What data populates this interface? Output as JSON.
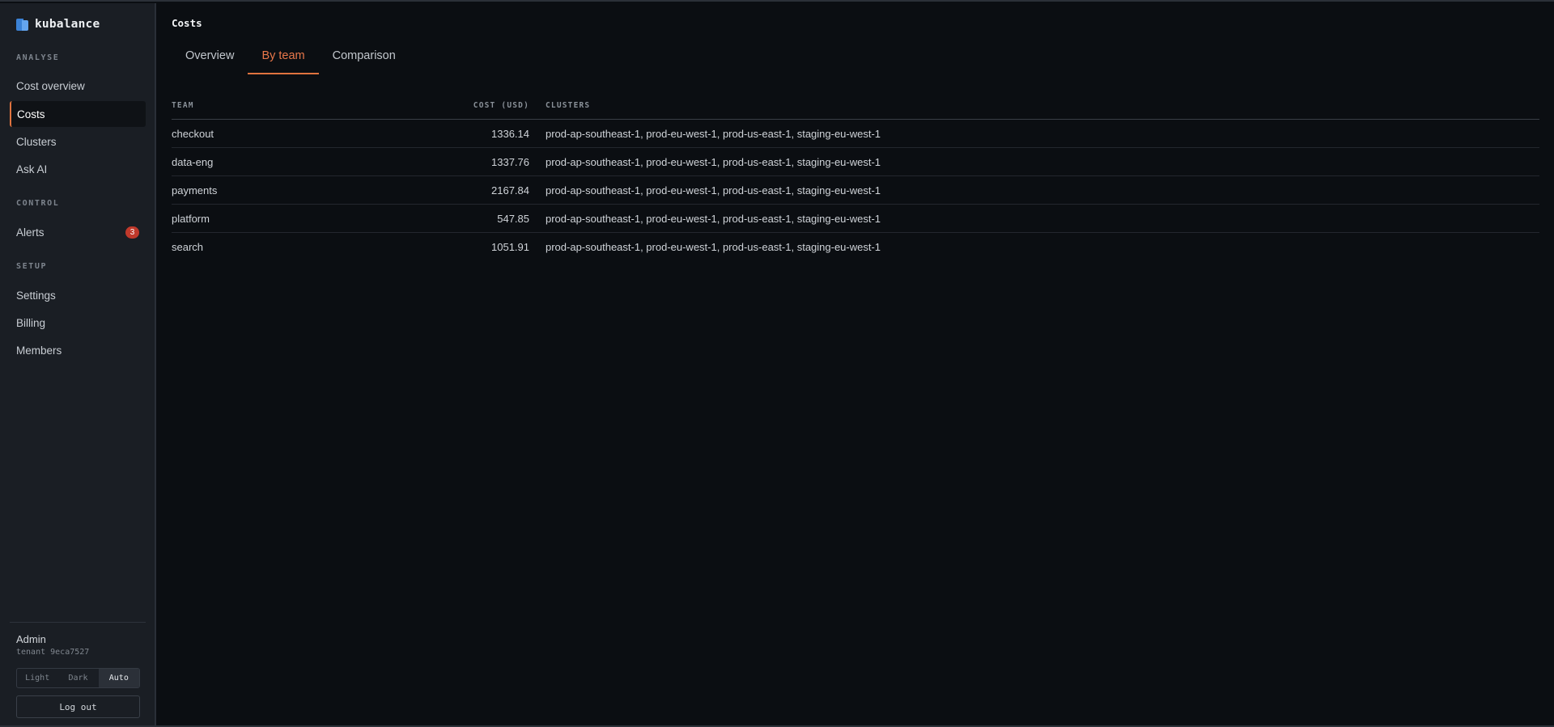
{
  "brand": {
    "name": "kubalance"
  },
  "sidebar": {
    "sections": [
      {
        "label": "ANALYSE"
      },
      {
        "label": "CONTROL"
      },
      {
        "label": "SETUP"
      }
    ],
    "items": [
      {
        "label": "Cost overview"
      },
      {
        "label": "Costs"
      },
      {
        "label": "Clusters"
      },
      {
        "label": "Ask AI"
      },
      {
        "label": "Alerts",
        "badge": "3"
      },
      {
        "label": "Settings"
      },
      {
        "label": "Billing"
      },
      {
        "label": "Members"
      }
    ],
    "active_item": "Costs"
  },
  "user": {
    "name": "Admin",
    "tenant": "tenant 9eca7527"
  },
  "theme": {
    "options": [
      "Light",
      "Dark",
      "Auto"
    ],
    "selected": "Auto"
  },
  "logout_label": "Log out",
  "page": {
    "title": "Costs",
    "tabs": [
      {
        "label": "Overview"
      },
      {
        "label": "By team"
      },
      {
        "label": "Comparison"
      }
    ],
    "active_tab": "By team"
  },
  "table": {
    "headers": {
      "team": "TEAM",
      "cost": "COST (USD)",
      "clusters": "CLUSTERS"
    },
    "rows": [
      {
        "team": "checkout",
        "cost": "1336.14",
        "clusters": "prod-ap-southeast-1, prod-eu-west-1, prod-us-east-1, staging-eu-west-1"
      },
      {
        "team": "data-eng",
        "cost": "1337.76",
        "clusters": "prod-ap-southeast-1, prod-eu-west-1, prod-us-east-1, staging-eu-west-1"
      },
      {
        "team": "payments",
        "cost": "2167.84",
        "clusters": "prod-ap-southeast-1, prod-eu-west-1, prod-us-east-1, staging-eu-west-1"
      },
      {
        "team": "platform",
        "cost": "547.85",
        "clusters": "prod-ap-southeast-1, prod-eu-west-1, prod-us-east-1, staging-eu-west-1"
      },
      {
        "team": "search",
        "cost": "1051.91",
        "clusters": "prod-ap-southeast-1, prod-eu-west-1, prod-us-east-1, staging-eu-west-1"
      }
    ]
  },
  "colors": {
    "accent": "#e0733f",
    "badge": "#c0392b",
    "brand_blue": "#3b82d6"
  },
  "icons": {
    "brand": "kubalance-logo-icon"
  }
}
